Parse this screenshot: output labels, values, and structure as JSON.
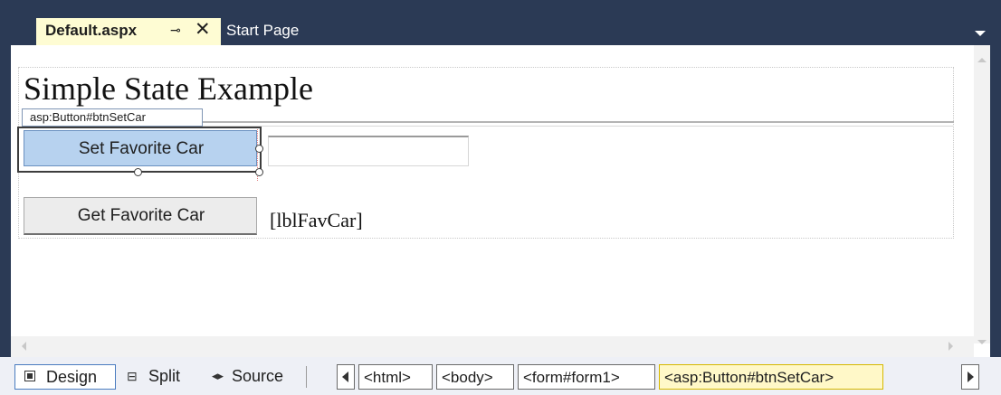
{
  "tabs": {
    "active_label": "Default.aspx",
    "pin_glyph": "⊸",
    "close_glyph": "✕",
    "other_label": "Start Page"
  },
  "design": {
    "heading": "Simple State Example",
    "smart_tag": "asp:Button#btnSetCar",
    "set_button": "Set Favorite Car",
    "get_button": "Get Favorite Car",
    "label_text": "[lblFavCar]"
  },
  "views": {
    "design": "Design",
    "split": "Split",
    "source": "Source"
  },
  "breadcrumb": [
    "<html>",
    "<body>",
    "<form#form1>",
    "<asp:Button#btnSetCar>"
  ],
  "icons": {
    "pin": "pin-icon",
    "close": "close-icon",
    "overflow": "chevron-down-icon",
    "design": "design-view-icon",
    "split": "split-view-icon",
    "source": "source-view-icon"
  },
  "colors": {
    "chrome": "#2b3a55",
    "active_tab": "#fefcd3",
    "selected_button": "#b7d2ef",
    "active_crumb": "#fff8c8"
  }
}
